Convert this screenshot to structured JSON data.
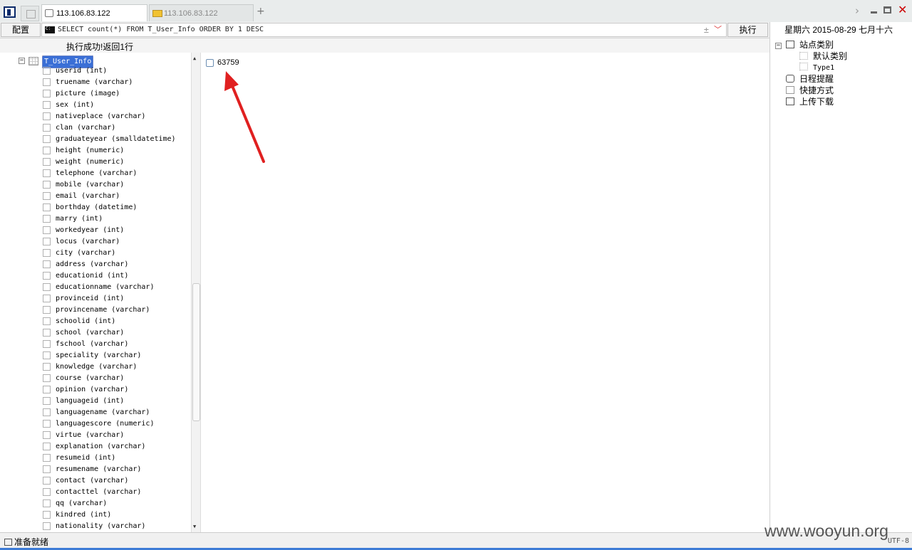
{
  "tabs": [
    {
      "label": "113.106.83.122",
      "active": true
    },
    {
      "label": "113.106.83.122",
      "active": false
    }
  ],
  "toolbar": {
    "config_label": "配置",
    "sql_query": "SELECT count(*) FROM T_User_Info ORDER BY 1 DESC",
    "plus_symbol": "±",
    "execute_label": "执行"
  },
  "status_message": "执行成功!返回1行",
  "tree": {
    "table_name": "T_User_Info",
    "columns": [
      "userid (int)",
      "truename (varchar)",
      "picture (image)",
      "sex (int)",
      "nativeplace (varchar)",
      "clan (varchar)",
      "graduateyear (smalldatetime)",
      "height (numeric)",
      "weight (numeric)",
      "telephone (varchar)",
      "mobile (varchar)",
      "email (varchar)",
      "borthday (datetime)",
      "marry (int)",
      "workedyear (int)",
      "locus (varchar)",
      "city (varchar)",
      "address (varchar)",
      "educationid (int)",
      "educationname (varchar)",
      "provinceid (int)",
      "provincename (varchar)",
      "schoolid (int)",
      "school (varchar)",
      "fschool (varchar)",
      "speciality (varchar)",
      "knowledge (varchar)",
      "course (varchar)",
      "opinion (varchar)",
      "languageid (int)",
      "languagename (varchar)",
      "languagescore (numeric)",
      "virtue (varchar)",
      "explanation (varchar)",
      "resumeid (int)",
      "resumename (varchar)",
      "contact (varchar)",
      "contacttel (varchar)",
      "qq (varchar)",
      "kindred (int)",
      "nationality (varchar)"
    ]
  },
  "result": {
    "value": "63759"
  },
  "right_panel": {
    "date_line": "星期六 2015-08-29 七月十六",
    "site_category": "站点类别",
    "default_category": "默认类别",
    "type1": "Type1",
    "schedule": "日程提醒",
    "shortcut": "快捷方式",
    "upload_download": "上传下载"
  },
  "bottom": {
    "ready": "准备就绪",
    "encoding": "UTF-8",
    "watermark": "www.wooyun.org"
  }
}
